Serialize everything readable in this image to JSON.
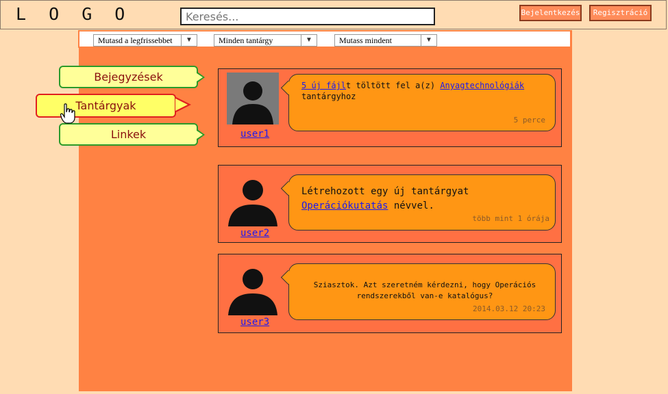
{
  "header": {
    "logo": "L O G O",
    "search_placeholder": "Keresés...",
    "login_label": "Bejelentkezés",
    "register_label": "Regisztráció"
  },
  "filters": [
    {
      "value": "Mutasd a legfrissebbet"
    },
    {
      "value": "Minden tantárgy"
    },
    {
      "value": "Mutass mindent"
    }
  ],
  "sidebar": {
    "items": [
      {
        "label": "Bejegyzések"
      },
      {
        "label": "Tantárgyak"
      },
      {
        "label": "Linkek"
      }
    ],
    "active_index": 1
  },
  "posts": [
    {
      "user": "user1",
      "link_text": "5 új fájl",
      "text_before": "t töltött fel a(z) ",
      "subject": "Anyagtechnológiák",
      "text_after": " tantárgyhoz",
      "time": "5 perce"
    },
    {
      "user": "user2",
      "text_before": "Létrehozott egy új tantárgyat ",
      "subject": "Operációkutatás",
      "text_after": " névvel.",
      "time": "több mint 1 órája"
    },
    {
      "user": "user3",
      "text": "Sziasztok. Azt szeretném kérdezni, hogy Operációs rendszerekből van-e katalógus?",
      "time": "2014.03.12 20:23"
    }
  ],
  "colors": {
    "page_bg": "#ffdcb3",
    "content_bg": "#ff8243",
    "post_bg": "#ff7043",
    "bubble_bg": "#ff9614",
    "tab_bg": "#ffff99",
    "tab_border": "#2a9a2a",
    "active_tab_border": "#e02020",
    "link": "#1a1aee"
  }
}
